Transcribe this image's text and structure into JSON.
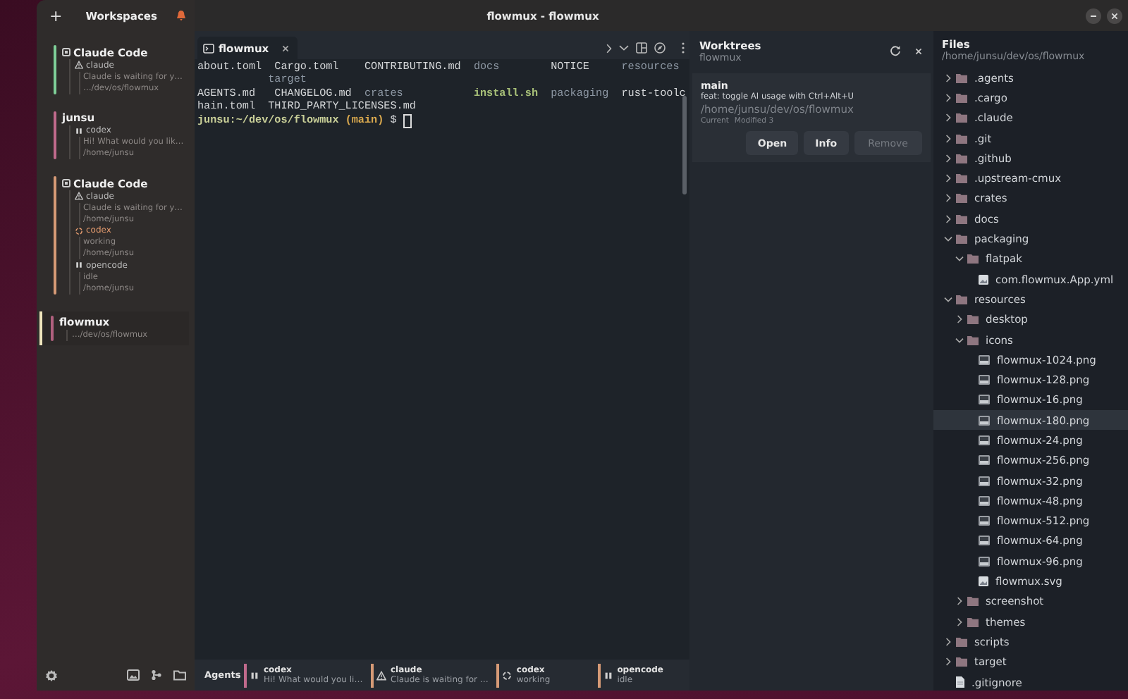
{
  "window": {
    "title": "flowmux - flowmux"
  },
  "sidebar": {
    "add_button": "+",
    "header": "Workspaces",
    "workspaces": [
      {
        "title": "Claude Code",
        "color": "#7ecf98",
        "selected": false,
        "agent_marker": true,
        "items": [
          {
            "kind": "waiting",
            "name": "claude",
            "lines": [
              "Claude is waiting for y…",
              "…/dev/os/flowmux"
            ]
          }
        ]
      },
      {
        "title": "junsu",
        "color": "#c06a8c",
        "selected": false,
        "agent_marker": false,
        "items": [
          {
            "kind": "paused",
            "name": "codex",
            "lines": [
              "Hi! What would you lik…",
              "/home/junsu"
            ]
          }
        ]
      },
      {
        "title": "Claude Code",
        "color": "#d69a76",
        "selected": false,
        "agent_marker": true,
        "items": [
          {
            "kind": "waiting",
            "name": "claude",
            "lines": [
              "Claude is waiting for y…",
              "/home/junsu"
            ]
          },
          {
            "kind": "working",
            "name": "codex",
            "lines": [
              "working",
              "/home/junsu"
            ]
          },
          {
            "kind": "paused",
            "name": "opencode",
            "lines": [
              "idle",
              "/home/junsu"
            ]
          }
        ]
      },
      {
        "title": "flowmux",
        "color": "#b0607e",
        "selected": true,
        "agent_marker": false,
        "items": [
          {
            "kind": "path",
            "text": "…/dev/os/flowmux"
          }
        ]
      }
    ]
  },
  "terminal": {
    "tab": {
      "title": "flowmux",
      "selected": true
    },
    "lines": [
      {
        "kind": "grid",
        "segments": [
          {
            "text": "about.toml",
            "kind": "file"
          },
          {
            "text": "Cargo.toml",
            "kind": "file"
          },
          {
            "text": "CONTRIBUTING.md",
            "kind": "file"
          },
          {
            "text": "docs",
            "kind": "dir"
          },
          {
            "text": "NOTICE",
            "kind": "file"
          },
          {
            "text": "resources",
            "kind": "dir"
          }
        ]
      },
      {
        "kind": "wrap",
        "segments": [
          {
            "text": "target",
            "kind": "dir"
          }
        ]
      },
      {
        "kind": "grid",
        "segments": [
          {
            "text": "AGENTS.md",
            "kind": "file"
          },
          {
            "text": "CHANGELOG.md",
            "kind": "file"
          },
          {
            "text": "crates",
            "kind": "dir"
          },
          {
            "text": "install.sh",
            "kind": "exec"
          },
          {
            "text": "packaging",
            "kind": "dir"
          },
          {
            "text": "rust-toolc",
            "kind": "file"
          }
        ]
      },
      {
        "kind": "wrap",
        "segments": [
          {
            "text": "hain.toml",
            "kind": "file"
          },
          {
            "text": "THIRD_PARTY_LICENSES.md",
            "kind": "file"
          }
        ]
      },
      {
        "kind": "prompt",
        "cursor": true,
        "segments": [
          {
            "text": "junsu:~/dev/os/flowmux",
            "kind": "prompt"
          },
          {
            "text": "(main)",
            "kind": "branch"
          },
          {
            "text": "$",
            "kind": "file"
          }
        ]
      }
    ]
  },
  "agents_bar": {
    "label": "Agents",
    "agents": [
      {
        "name": "codex",
        "kind": "paused",
        "detail": "Hi! What would you li…",
        "color": "#c06a8c"
      },
      {
        "name": "claude",
        "kind": "waiting",
        "detail": "Claude is waiting for …",
        "color": "#d69a76"
      },
      {
        "name": "codex",
        "kind": "working",
        "detail": "working",
        "color": "#d69a76"
      },
      {
        "name": "opencode",
        "kind": "paused",
        "detail": "idle",
        "color": "#d69a76"
      }
    ]
  },
  "worktrees": {
    "title": "Worktrees",
    "subtitle": "flowmux",
    "entries": [
      {
        "branch": "main",
        "message": "feat: toggle AI usage with Ctrl+Alt+U",
        "path": "/home/junsu/dev/os/flowmux",
        "status": [
          "Current",
          "Modified 3"
        ],
        "buttons": [
          {
            "label": "Open",
            "disabled": false
          },
          {
            "label": "Info",
            "disabled": false
          },
          {
            "label": "Remove",
            "disabled": true
          }
        ]
      }
    ]
  },
  "files": {
    "title": "Files",
    "path": "/home/junsu/dev/os/flowmux",
    "tree": [
      {
        "name": ".agents",
        "kind": "folder",
        "expanded": false,
        "selected": false
      },
      {
        "name": ".cargo",
        "kind": "folder",
        "expanded": false,
        "selected": false
      },
      {
        "name": ".claude",
        "kind": "folder",
        "expanded": false,
        "selected": false
      },
      {
        "name": ".git",
        "kind": "folder",
        "expanded": false,
        "selected": false
      },
      {
        "name": ".github",
        "kind": "folder",
        "expanded": false,
        "selected": false
      },
      {
        "name": ".upstream-cmux",
        "kind": "folder",
        "expanded": false,
        "selected": false
      },
      {
        "name": "crates",
        "kind": "folder",
        "expanded": false,
        "selected": false
      },
      {
        "name": "docs",
        "kind": "folder",
        "expanded": false,
        "selected": false
      },
      {
        "name": "packaging",
        "kind": "folder",
        "expanded": true,
        "selected": false,
        "children": [
          {
            "name": "flatpak",
            "kind": "folder",
            "expanded": true,
            "selected": false,
            "children": [
              {
                "name": "com.flowmux.App.yml",
                "kind": "config",
                "selected": false
              }
            ]
          }
        ]
      },
      {
        "name": "resources",
        "kind": "folder",
        "expanded": true,
        "selected": false,
        "children": [
          {
            "name": "desktop",
            "kind": "folder",
            "expanded": false,
            "selected": false
          },
          {
            "name": "icons",
            "kind": "folder",
            "expanded": true,
            "selected": false,
            "children": [
              {
                "name": "flowmux-1024.png",
                "kind": "image",
                "selected": false
              },
              {
                "name": "flowmux-128.png",
                "kind": "image",
                "selected": false
              },
              {
                "name": "flowmux-16.png",
                "kind": "image",
                "selected": false
              },
              {
                "name": "flowmux-180.png",
                "kind": "image",
                "selected": true
              },
              {
                "name": "flowmux-24.png",
                "kind": "image",
                "selected": false
              },
              {
                "name": "flowmux-256.png",
                "kind": "image",
                "selected": false
              },
              {
                "name": "flowmux-32.png",
                "kind": "image",
                "selected": false
              },
              {
                "name": "flowmux-48.png",
                "kind": "image",
                "selected": false
              },
              {
                "name": "flowmux-512.png",
                "kind": "image",
                "selected": false
              },
              {
                "name": "flowmux-64.png",
                "kind": "image",
                "selected": false
              },
              {
                "name": "flowmux-96.png",
                "kind": "image",
                "selected": false
              },
              {
                "name": "flowmux.svg",
                "kind": "config",
                "selected": false
              }
            ]
          },
          {
            "name": "screenshot",
            "kind": "folder",
            "expanded": false,
            "selected": false
          },
          {
            "name": "themes",
            "kind": "folder",
            "expanded": false,
            "selected": false
          }
        ]
      },
      {
        "name": "scripts",
        "kind": "folder",
        "expanded": false,
        "selected": false
      },
      {
        "name": "target",
        "kind": "folder",
        "expanded": false,
        "selected": false
      },
      {
        "name": ".gitignore",
        "kind": "text",
        "selected": false
      }
    ]
  }
}
